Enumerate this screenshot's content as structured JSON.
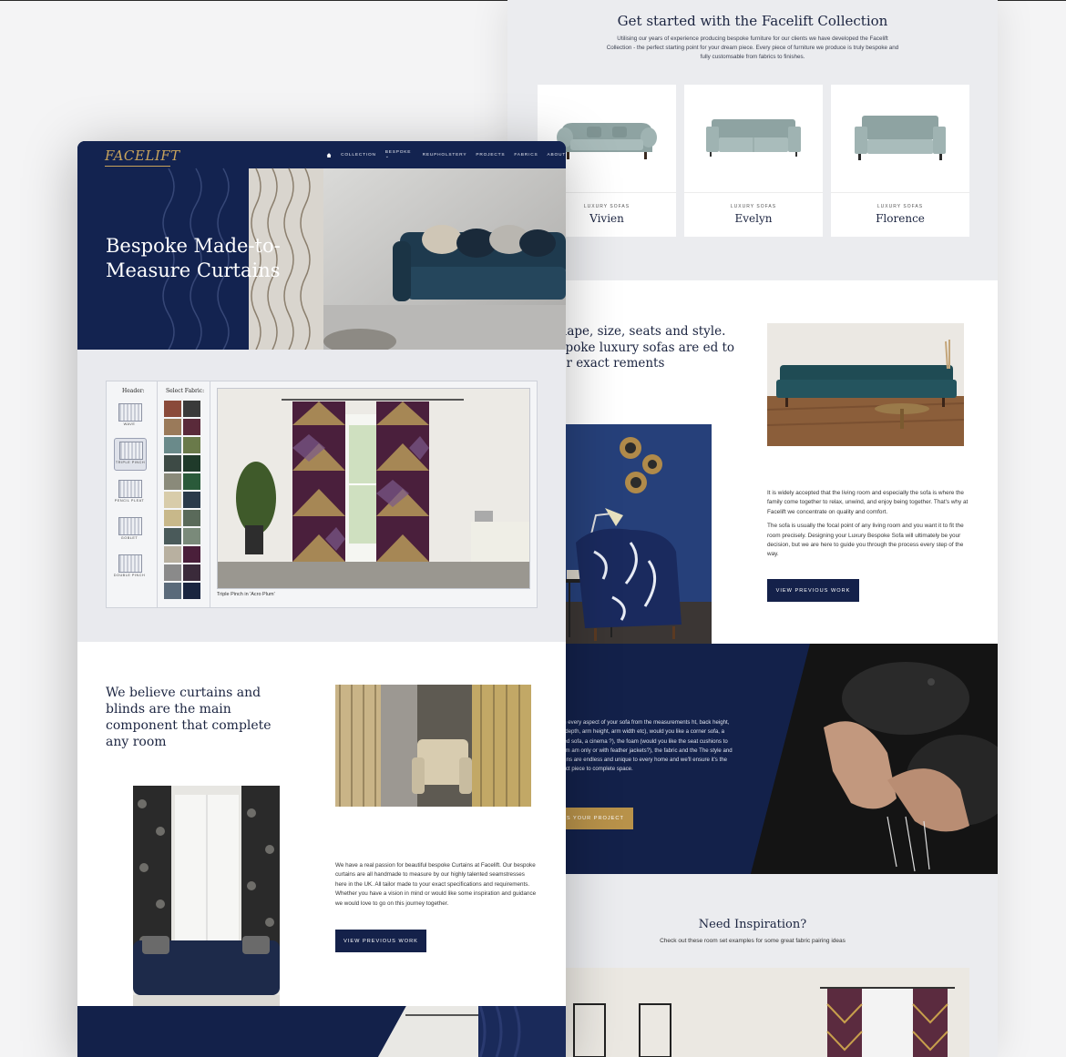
{
  "colors": {
    "navy": "#13214a",
    "gold": "#b8924a",
    "light_bg": "#ebecef"
  },
  "back": {
    "collection": {
      "title": "Get started with the Facelift Collection",
      "description": "Utilising our years of experience producing bespoke furniture for our clients we have developed the Facelift Collection - the perfect starting point for your dream piece. Every piece of furniture we produce is truly bespoke and fully customsable from fabrics to finishes.",
      "products": [
        {
          "category": "LUXURY SOFAS",
          "name": "Vivien"
        },
        {
          "category": "LUXURY SOFAS",
          "name": "Evelyn"
        },
        {
          "category": "LUXURY SOFAS",
          "name": "Florence"
        }
      ]
    },
    "shape": {
      "title": "t shape, size, seats and style. bespoke luxury sofas are ed to your exact rements",
      "paragraph1": "It is widely accepted that the living room and especially the sofa is where the family come together to relax, unwind, and enjoy being together. That's why at Facelift we concentrate on quality and comfort.",
      "paragraph2": "The sofa is usually the focal point of any living room and you want it to fit the room precisely. Designing your Luxury Bespoke Sofa will ultimately be your decision, but we are here to guide you through the process every step of the way.",
      "button": "VIEW PREVIOUS WORK"
    },
    "design": {
      "text": "esign every aspect of your sofa from the measurements ht, back height, seat depth, arm height, arm width etc), would you like a corner sofa, a curved sofa, a cinema ?), the foam (would you like the seat cushions to be firm am only or with feather jackets?), the fabric and the The style and designs are endless and unique to every home and we'll ensure it's the perfect piece to complete space.",
      "button": "SS YOUR PROJECT"
    },
    "inspiration": {
      "title": "Need Inspiration?",
      "subtitle": "Check out these room set examples for some great fabric pairing ideas"
    }
  },
  "front": {
    "logo": "FACELIFT",
    "nav": [
      "COLLECTION",
      "BESPOKE ⌄",
      "REUPHOLSTERY",
      "PROJECTS",
      "FABRICS",
      "ABOUT"
    ],
    "hero_title": "Bespoke Made-to-Measure Curtains",
    "picker": {
      "header_label": "Header:",
      "fabric_label": "Select Fabric:",
      "headers": [
        "WAVE",
        "TRIPLE PINCH",
        "PENCIL PLEAT",
        "GOBLET",
        "DOUBLE PINCH"
      ],
      "selected_header": "TRIPLE PINCH",
      "caption": "Triple Pinch in 'Acro Plum'"
    },
    "believe": {
      "title": "We believe curtains and blinds are the main component that complete any room",
      "paragraph": "We have a real passion for beautiful bespoke Curtains at Facelift. Our bespoke curtains are all handmade to measure by our highly talented seamstresses here in the UK. All tailor made to your exact specifications and requirements. Whether you have a vision in mind or would like some inspiration and guidance we would love to go on this journey together.",
      "button": "VIEW PREVIOUS WORK"
    }
  }
}
